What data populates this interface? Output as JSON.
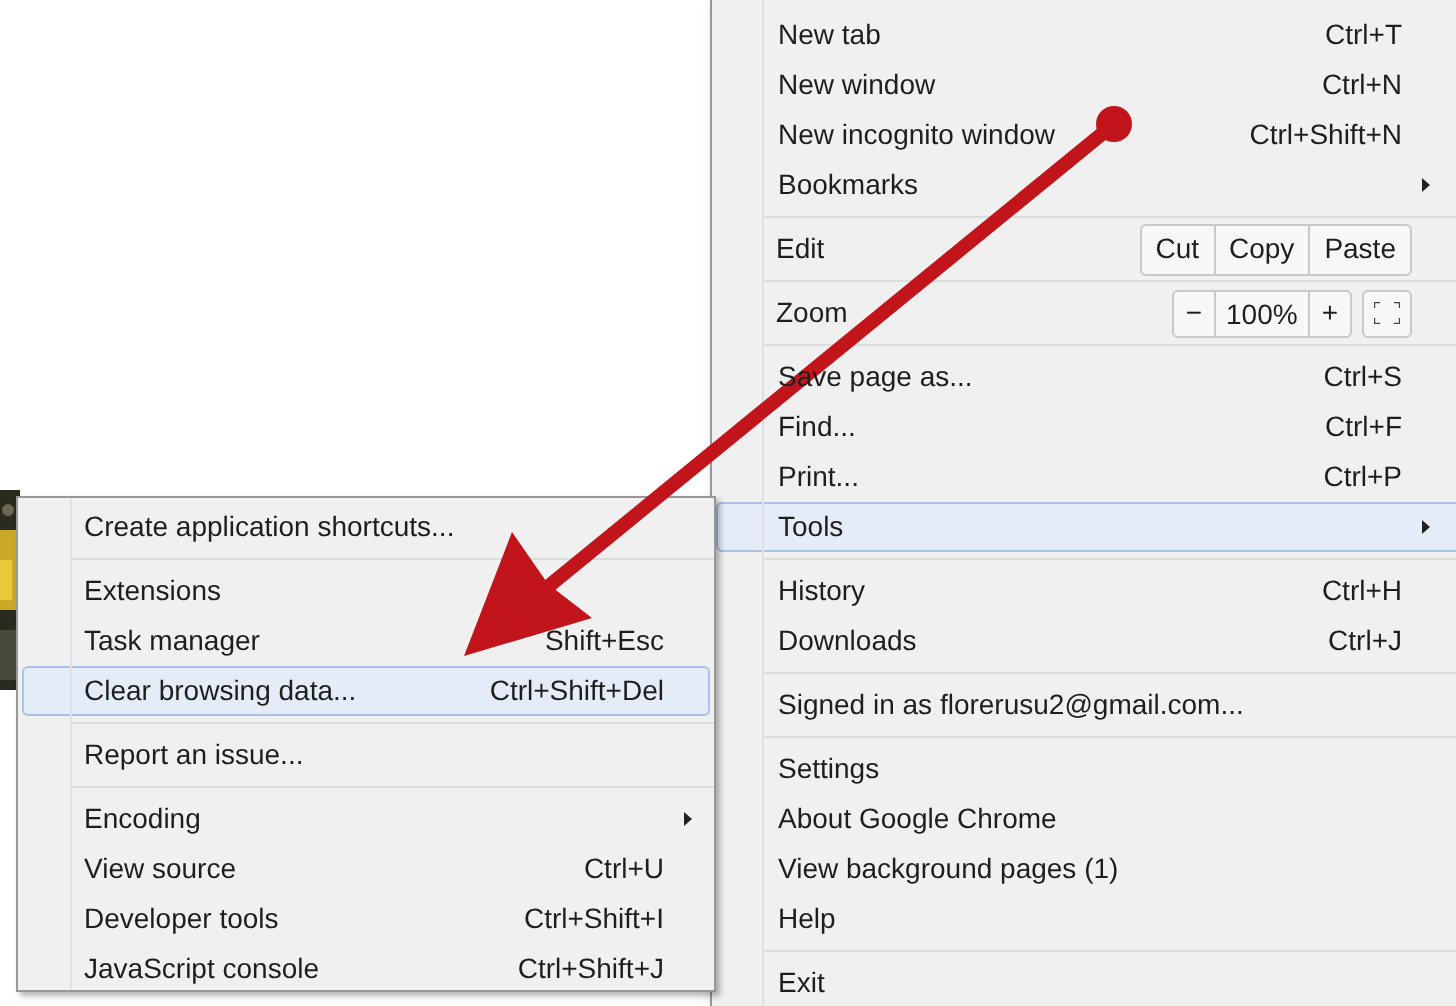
{
  "main_menu": {
    "items": [
      {
        "kind": "item",
        "label": "New tab",
        "shortcut": "Ctrl+T",
        "submenu": false,
        "selected": false
      },
      {
        "kind": "item",
        "label": "New window",
        "shortcut": "Ctrl+N",
        "submenu": false,
        "selected": false
      },
      {
        "kind": "item",
        "label": "New incognito window",
        "shortcut": "Ctrl+Shift+N",
        "submenu": false,
        "selected": false
      },
      {
        "kind": "item",
        "label": "Bookmarks",
        "submenu": true,
        "selected": false
      },
      {
        "kind": "separator"
      },
      {
        "kind": "edit",
        "label": "Edit",
        "buttons": [
          "Cut",
          "Copy",
          "Paste"
        ]
      },
      {
        "kind": "separator"
      },
      {
        "kind": "zoom",
        "label": "Zoom",
        "minus": "−",
        "value": "100%",
        "plus": "+"
      },
      {
        "kind": "separator"
      },
      {
        "kind": "item",
        "label": "Save page as...",
        "shortcut": "Ctrl+S",
        "submenu": false,
        "selected": false
      },
      {
        "kind": "item",
        "label": "Find...",
        "shortcut": "Ctrl+F",
        "submenu": false,
        "selected": false
      },
      {
        "kind": "item",
        "label": "Print...",
        "shortcut": "Ctrl+P",
        "submenu": false,
        "selected": false
      },
      {
        "kind": "item",
        "label": "Tools",
        "submenu": true,
        "selected": true
      },
      {
        "kind": "separator"
      },
      {
        "kind": "item",
        "label": "History",
        "shortcut": "Ctrl+H",
        "submenu": false,
        "selected": false
      },
      {
        "kind": "item",
        "label": "Downloads",
        "shortcut": "Ctrl+J",
        "submenu": false,
        "selected": false
      },
      {
        "kind": "separator"
      },
      {
        "kind": "item",
        "label": "Signed in as florerusu2@gmail.com...",
        "submenu": false,
        "selected": false
      },
      {
        "kind": "separator"
      },
      {
        "kind": "item",
        "label": "Settings",
        "submenu": false,
        "selected": false
      },
      {
        "kind": "item",
        "label": "About Google Chrome",
        "submenu": false,
        "selected": false
      },
      {
        "kind": "item",
        "label": "View background pages (1)",
        "submenu": false,
        "selected": false
      },
      {
        "kind": "item",
        "label": "Help",
        "submenu": false,
        "selected": false
      },
      {
        "kind": "separator"
      },
      {
        "kind": "item",
        "label": "Exit",
        "submenu": false,
        "selected": false
      }
    ]
  },
  "tools_submenu": {
    "items": [
      {
        "kind": "item",
        "label": "Create application shortcuts...",
        "submenu": false,
        "selected": false
      },
      {
        "kind": "separator"
      },
      {
        "kind": "item",
        "label": "Extensions",
        "submenu": false,
        "selected": false
      },
      {
        "kind": "item",
        "label": "Task manager",
        "shortcut": "Shift+Esc",
        "submenu": false,
        "selected": false
      },
      {
        "kind": "item",
        "label": "Clear browsing data...",
        "shortcut": "Ctrl+Shift+Del",
        "submenu": false,
        "selected": true
      },
      {
        "kind": "separator"
      },
      {
        "kind": "item",
        "label": "Report an issue...",
        "submenu": false,
        "selected": false
      },
      {
        "kind": "separator"
      },
      {
        "kind": "item",
        "label": "Encoding",
        "submenu": true,
        "selected": false
      },
      {
        "kind": "item",
        "label": "View source",
        "shortcut": "Ctrl+U",
        "submenu": false,
        "selected": false
      },
      {
        "kind": "item",
        "label": "Developer tools",
        "shortcut": "Ctrl+Shift+I",
        "submenu": false,
        "selected": false
      },
      {
        "kind": "item",
        "label": "JavaScript console",
        "shortcut": "Ctrl+Shift+J",
        "submenu": false,
        "selected": false
      }
    ]
  }
}
